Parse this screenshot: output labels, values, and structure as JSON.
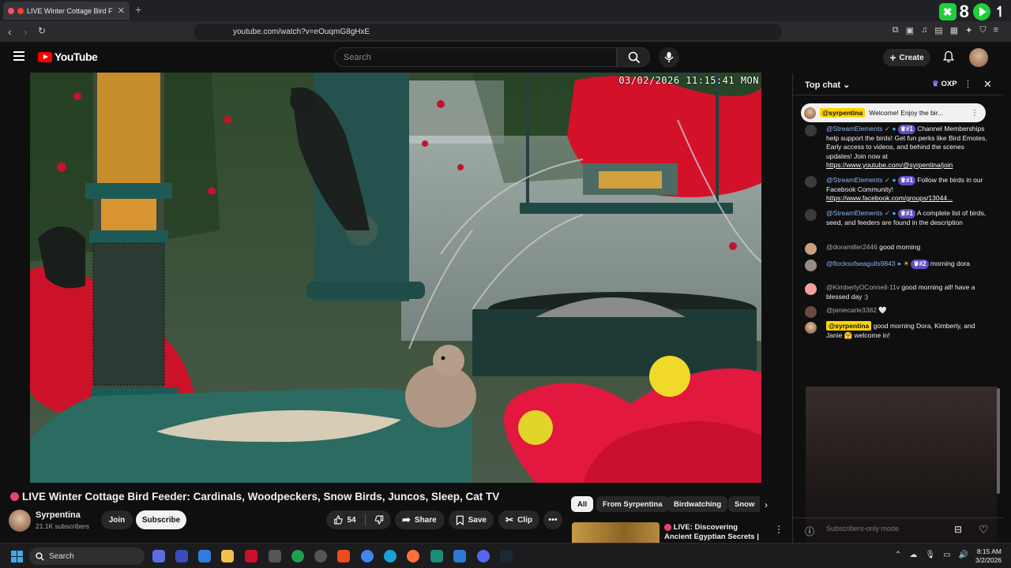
{
  "browser": {
    "tab_title": "LIVE Winter Cottage Bird F",
    "url": "youtube.com/watch?v=eOuqmG8gHxE",
    "ext_count": "8"
  },
  "header": {
    "logo_text": "YouTube",
    "search_placeholder": "Search",
    "create_label": "Create"
  },
  "video": {
    "overlay_timestamp": "03/02/2026 11:15:41 MON",
    "title": "LIVE Winter Cottage Bird Feeder: Cardinals, Woodpeckers, Snow Birds, Juncos, Sleep, Cat TV",
    "channel_name": "Syrpentina",
    "subscribers": "21.1K subscribers",
    "join_label": "Join",
    "subscribe_label": "Subscribe",
    "like_count": "54",
    "share_label": "Share",
    "save_label": "Save",
    "clip_label": "Clip"
  },
  "chips": [
    "All",
    "From Syrpentina",
    "Birdwatching",
    "Snow"
  ],
  "related": {
    "title": "LIVE: Discovering Ancient Egyptian Secrets | Lost ..."
  },
  "chat": {
    "title": "Top chat",
    "oxp": "OXP",
    "pinned_user": "@syrpentina",
    "pinned_text": "Welcome! Enjoy the bir...",
    "messages": [
      {
        "user": "@StreamElements",
        "badge": "#1",
        "text": "Channel Memberships help support the birds! Get fun perks like Bird Emotes, Early access to videos, and behind the scenes updates! Join now at ",
        "link": "https://www.youtube.com/@syrpentina/join"
      },
      {
        "user": "@StreamElements",
        "badge": "#1",
        "text": "Follow the birds in our Facebook Community! ",
        "link": "https://www.facebook.com/groups/13044..."
      },
      {
        "user": "@StreamElements",
        "badge": "#1",
        "text": "A complete list of birds, seed, and feeders are found in the description",
        "link": ""
      },
      {
        "user": "@doramiller2446",
        "badge": "",
        "text": "good morning",
        "link": ""
      },
      {
        "user": "@flocksofseagulls9843",
        "badge": "#2",
        "text": "morning dora",
        "link": ""
      },
      {
        "user": "@KimberlyOConnell-11v",
        "badge": "",
        "text": "good morning all! have a blessed day :)",
        "link": ""
      },
      {
        "user": "@janiecarle3382",
        "badge": "",
        "text": "🤍",
        "link": ""
      },
      {
        "user": "@syrpentina",
        "badge": "",
        "text": "good morning Dora, Kimberly, and Janie 🤗 welcome in!",
        "link": ""
      }
    ],
    "input_placeholder": "Subscribers-only mode"
  },
  "taskbar": {
    "search_label": "Search",
    "time": "8:15 AM",
    "date": "3/2/2026"
  }
}
